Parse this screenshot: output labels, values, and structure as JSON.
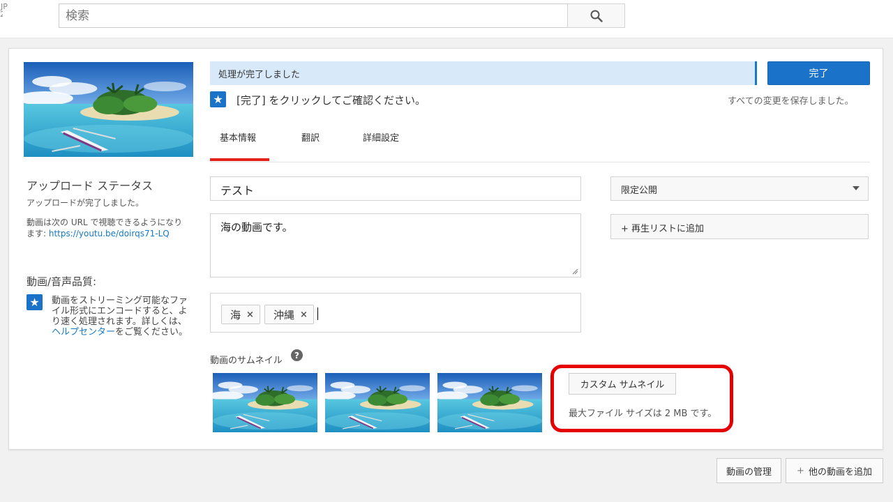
{
  "header": {
    "region_top": "JP",
    "region_bottom": "2",
    "search_placeholder": "検索",
    "search_icon": "search-icon"
  },
  "sidebar": {
    "upload_status_title": "アップロード ステータス",
    "upload_done": "アップロードが完了しました。",
    "url_prefix": "動画は次の URL で視聴できるようになります: ",
    "url": "https://youtu.be/doirqs71-LQ",
    "quality_title": "動画/音声品質:",
    "note_prefix": "動画をストリーミング可能なファイル形式にエンコードすると、より速く処理されます。詳しくは、",
    "note_link": "ヘルプセンター",
    "note_suffix": "をご覧ください。"
  },
  "status": {
    "progress_text": "処理が完了しました",
    "done_button": "完了",
    "confirm_text": "[完了] をクリックしてご確認ください。",
    "saved_text": "すべての変更を保存しました。"
  },
  "tabs": [
    {
      "label": "基本情報",
      "active": true
    },
    {
      "label": "翻訳",
      "active": false
    },
    {
      "label": "詳細設定",
      "active": false
    }
  ],
  "form": {
    "title_value": "テスト",
    "description_value": "海の動画です。",
    "tags": [
      {
        "label": "海",
        "remove": "×"
      },
      {
        "label": "沖縄",
        "remove": "×"
      }
    ],
    "privacy_value": "限定公開",
    "playlist_label": "+ 再生リストに追加"
  },
  "thumbnails": {
    "label": "動画のサムネイル",
    "help_icon": "?",
    "custom_button": "カスタム サムネイル",
    "max_size_text": "最大ファイル サイズは 2 MB です。",
    "highlight_color": "#e60000"
  },
  "footer": {
    "manage_button": "動画の管理",
    "add_button": "他の動画を追加",
    "add_icon": "+"
  },
  "colors": {
    "accent_blue": "#1a73c8",
    "tab_underline": "#e62117",
    "progress_bg": "#d8e9fa"
  }
}
